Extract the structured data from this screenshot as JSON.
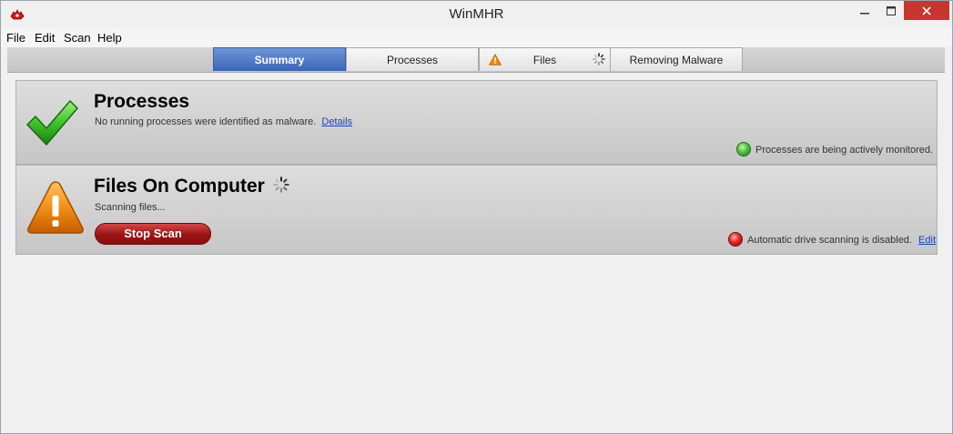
{
  "window": {
    "title": "WinMHR"
  },
  "icons": {
    "app": "winmhr-app-icon",
    "minimize": "minimize-icon",
    "maximize": "maximize-icon",
    "close": "close-icon"
  },
  "menu": [
    "File",
    "Edit",
    "Scan",
    "Help"
  ],
  "tabs": [
    {
      "label": "Summary",
      "active": true
    },
    {
      "label": "Processes",
      "active": false
    },
    {
      "label": "Files",
      "active": false,
      "icons": [
        "warning-icon",
        "spinner-icon"
      ]
    },
    {
      "label": "Removing Malware",
      "active": false
    }
  ],
  "processes": {
    "title": "Processes",
    "description": "No running processes were identified as malware.",
    "details_link": "Details",
    "status_text": "Processes are being actively monitored.",
    "status_color": "#3cb22c",
    "icon": "green-checkmark-icon"
  },
  "files": {
    "title": "Files On Computer",
    "description": "Scanning files...",
    "button": "Stop Scan",
    "status_text": "Automatic drive scanning is disabled.",
    "edit_link": "Edit",
    "status_color": "#d81f1f",
    "icon": "orange-warning-icon"
  },
  "colors": {
    "active_tab": "#3a64b9",
    "stop_button": "#9a1414",
    "close_button": "#c7372f"
  }
}
